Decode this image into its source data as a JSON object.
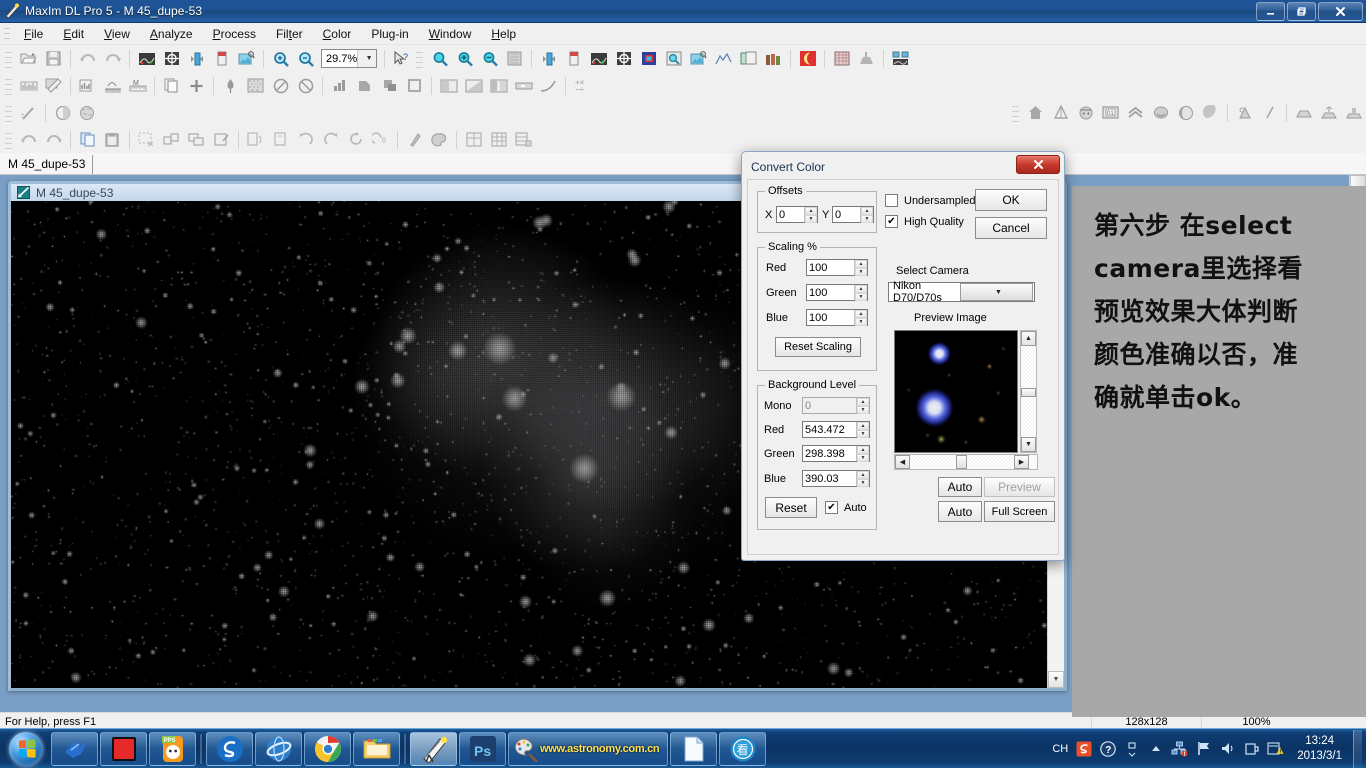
{
  "window": {
    "title": "MaxIm DL Pro 5 - M 45_dupe-53",
    "app_icon": "telescope-icon",
    "minimize_label": "—",
    "maximize_label": "❐",
    "close_label": "✕"
  },
  "menubar": {
    "items": [
      {
        "label": "File",
        "accel": "F"
      },
      {
        "label": "Edit",
        "accel": "E"
      },
      {
        "label": "View",
        "accel": "V"
      },
      {
        "label": "Analyze",
        "accel": "A"
      },
      {
        "label": "Process",
        "accel": "P"
      },
      {
        "label": "Filter",
        "accel": "t"
      },
      {
        "label": "Color",
        "accel": "C"
      },
      {
        "label": "Plug-in",
        "accel": "g"
      },
      {
        "label": "Window",
        "accel": "W"
      },
      {
        "label": "Help",
        "accel": "H"
      }
    ]
  },
  "toolbar": {
    "zoom_value": "29.7%",
    "row1_icons": [
      "open-file-icon",
      "save-icon",
      "undo-icon",
      "redo-icon",
      "screen-stretch-icon",
      "crosshair-icon",
      "flip-icon",
      "calibrate-icon",
      "batch-process-icon",
      "zoom-in-icon",
      "zoom-out-icon"
    ],
    "row1_right_icons": [
      "help-pointer-icon",
      "magnifier-cyan-icon",
      "zoom-in-magnifier-icon",
      "zoom-out-magnifier-icon",
      "zoom-fit-icon",
      "flip-icon",
      "calibrate-icon",
      "screen-stretch-icon",
      "crosshair-icon",
      "color-frame-icon",
      "inspect-icon",
      "batch-process-icon",
      "graph-icon",
      "stack-icon",
      "library-icon",
      "moon-icon",
      "grid-icon",
      "observatory-icon",
      "mosaic-icon"
    ],
    "row2_icons": [
      "histogram-icon",
      "measure-icon",
      "column-graph-icon",
      "line-profile-icon",
      "magnitude-icon",
      "copy-info-icon",
      "add-icon",
      "pin-icon",
      "noise-icon",
      "circle-slash-icon",
      "circle-slash2-icon",
      "bar-chart-icon",
      "shapes-icon",
      "shapes2-icon",
      "square-icon",
      "dither1-icon",
      "dither2-icon",
      "dither3-icon",
      "strip-icon",
      "curve-icon",
      "math-icon"
    ],
    "row3_icons": [
      "wand-icon",
      "planet-icon",
      "planet-color-icon",
      "home-icon",
      "balance-icon",
      "face-icon",
      "filmstrip-icon",
      "chevrons-icon",
      "oval-icon",
      "globe-icon",
      "moon-crescent-icon",
      "bird-icon",
      "slash-icon",
      "tray1-icon",
      "tray2-icon",
      "tray3-icon"
    ],
    "row4_icons": [
      "undo-icon",
      "redo-icon",
      "copy-icon",
      "paste-icon",
      "cut-select-icon",
      "group-icon",
      "layers-icon",
      "edit-shape-icon",
      "page1-icon",
      "page2-icon",
      "rotate-left-icon",
      "rotate-right-icon",
      "rotate-icon",
      "rotate-angle-icon",
      "pencil-icon",
      "palette-icon",
      "table1-icon",
      "table2-icon",
      "table3-icon"
    ]
  },
  "tabstrip": {
    "tabs": [
      {
        "label": "M 45_dupe-53"
      }
    ]
  },
  "child_window": {
    "title": "M 45_dupe-53",
    "icon": "image-doc-icon"
  },
  "statusbar": {
    "help_text": "For Help, press F1",
    "dimensions": "128x128",
    "zoom": "100%"
  },
  "dialog": {
    "title": "Convert Color",
    "close_label": "✕",
    "offsets": {
      "legend": "Offsets",
      "x_label": "X",
      "x_value": "0",
      "y_label": "Y",
      "y_value": "0"
    },
    "scaling": {
      "legend": "Scaling %",
      "rows": [
        {
          "label": "Red",
          "value": "100"
        },
        {
          "label": "Green",
          "value": "100"
        },
        {
          "label": "Blue",
          "value": "100"
        }
      ],
      "reset_label": "Reset Scaling"
    },
    "background": {
      "legend": "Background Level",
      "rows": [
        {
          "label": "Mono",
          "value": "0",
          "disabled": true
        },
        {
          "label": "Red",
          "value": "543.472",
          "disabled": false
        },
        {
          "label": "Green",
          "value": "298.398",
          "disabled": false
        },
        {
          "label": "Blue",
          "value": "390.03",
          "disabled": false
        }
      ],
      "reset_label": "Reset",
      "auto_label": "Auto",
      "auto_checked": true
    },
    "options": {
      "undersampled_label": "Undersampled",
      "undersampled_checked": false,
      "high_quality_label": "High Quality",
      "high_quality_checked": true
    },
    "ok_label": "OK",
    "cancel_label": "Cancel",
    "select_camera": {
      "label": "Select Camera",
      "value": "Nikon D70/D70s"
    },
    "preview": {
      "label": "Preview Image",
      "auto_label_1": "Auto",
      "preview_label": "Preview",
      "preview_disabled": true,
      "auto_label_2": "Auto",
      "fullscreen_label": "Full Screen"
    }
  },
  "annotation": {
    "background_color": "#a8a8a8",
    "lines": [
      "第六步 在select",
      "camera里选择看",
      "预览效果大体判断",
      "颜色准确以否，准",
      "确就单击ok。"
    ]
  },
  "taskbar": {
    "start_label": "start-orb",
    "items": [
      {
        "name": "taskbar-item-bird",
        "icon": "blue-bird-icon"
      },
      {
        "name": "taskbar-item-red",
        "icon": "red-square-icon"
      },
      {
        "name": "taskbar-item-pps",
        "icon": "pps-icon",
        "badge": "PPS"
      },
      {
        "name": "taskbar-item-sogou",
        "icon": "sogou-icon"
      },
      {
        "name": "taskbar-item-ie",
        "icon": "internet-explorer-icon"
      },
      {
        "name": "taskbar-item-chrome",
        "icon": "chrome-icon"
      },
      {
        "name": "taskbar-item-explorer",
        "icon": "folder-icon"
      },
      {
        "name": "taskbar-item-maxim",
        "icon": "telescope-icon"
      },
      {
        "name": "taskbar-item-photoshop",
        "icon": "ps-icon",
        "label": "Ps"
      },
      {
        "name": "taskbar-item-astronomy",
        "icon": "paint-icon",
        "label": "www.astronomy.com.cn"
      },
      {
        "name": "taskbar-item-document",
        "icon": "document-icon"
      },
      {
        "name": "taskbar-item-kan",
        "icon": "kan-icon",
        "label": "看"
      }
    ],
    "tray": {
      "ime_label": "CH",
      "icons": [
        "sogou-s-icon",
        "help-icon",
        "expand-icon",
        "show-hidden-icon",
        "network-icon",
        "flag-icon",
        "volume-icon",
        "usb-icon",
        "action-center-icon"
      ],
      "time": "13:24",
      "date": "2013/3/1"
    }
  },
  "colors": {
    "accent": "#1f5498",
    "dialog_bg": "#f0f0f0",
    "annotation_bg": "#a8a8a8",
    "close_red": "#c7392b",
    "mdi_bg": "#7a9fc4"
  }
}
